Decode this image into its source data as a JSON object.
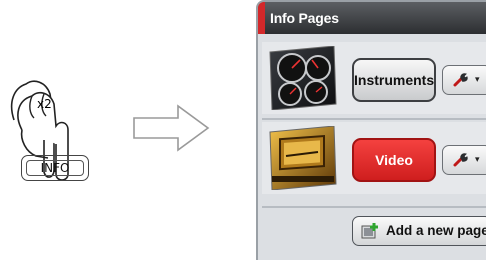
{
  "illustration": {
    "press_count": "x2",
    "key_label": "INFO"
  },
  "panel": {
    "title": "Info Pages",
    "rows": [
      {
        "label": "Instruments",
        "thumbnail_icon": "gauges-icon",
        "tool_icon": "wrench-icon"
      },
      {
        "label": "Video",
        "thumbnail_icon": "video-film-icon",
        "tool_icon": "wrench-icon"
      }
    ],
    "add_page_label": "Add a new page"
  },
  "colors": {
    "accent_red": "#d3282a",
    "video_button": "#e02a28",
    "header_dark": "#2c2e31",
    "panel_bg": "#dcdfe3"
  }
}
